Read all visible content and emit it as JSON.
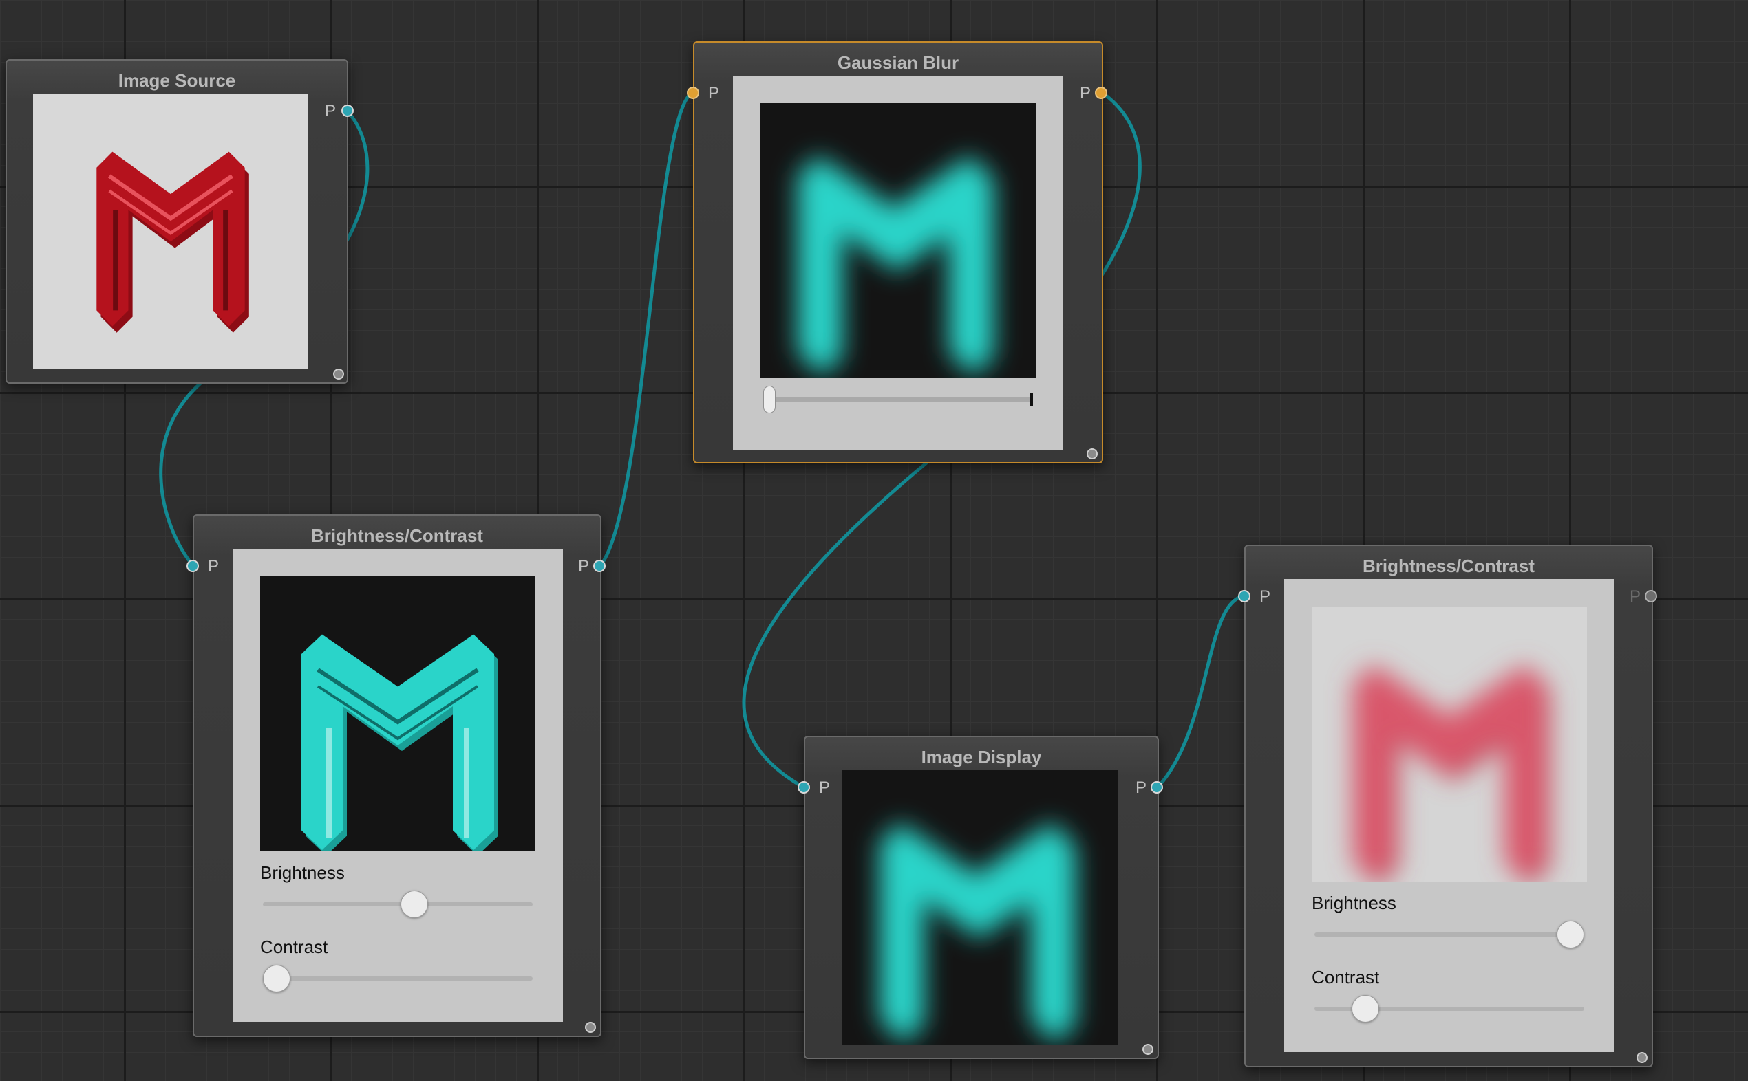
{
  "canvas": {
    "background": "#2e2e2e"
  },
  "colors": {
    "wire": "#138a93",
    "port_teal": "#2ea5b3",
    "port_selected": "#e0a033",
    "selected_border": "#c58a2a",
    "logo_red": "#b5121d",
    "logo_cyan": "#2ad4c9",
    "logo_pink": "#d9566a"
  },
  "nodes": {
    "image_source": {
      "title": "Image Source",
      "out_port": "P",
      "image": "red-m-logo"
    },
    "gaussian_blur": {
      "title": "Gaussian Blur",
      "in_port": "P",
      "out_port": "P",
      "image": "cyan-m-logo-blurred",
      "blur_level": 0.0,
      "selected": true
    },
    "brightness_contrast_1": {
      "title": "Brightness/Contrast",
      "in_port": "P",
      "out_port": "P",
      "image": "cyan-m-logo",
      "brightness_label": "Brightness",
      "contrast_label": "Contrast",
      "brightness_level": 0.57,
      "contrast_level": 0.05
    },
    "image_display": {
      "title": "Image Display",
      "in_port": "P",
      "out_port": "P",
      "image": "cyan-m-logo-blurred"
    },
    "brightness_contrast_2": {
      "title": "Brightness/Contrast",
      "in_port": "P",
      "out_port": "P",
      "image": "pink-m-logo-blurred",
      "brightness_label": "Brightness",
      "contrast_label": "Contrast",
      "brightness_level": 0.95,
      "contrast_level": 0.14
    }
  }
}
